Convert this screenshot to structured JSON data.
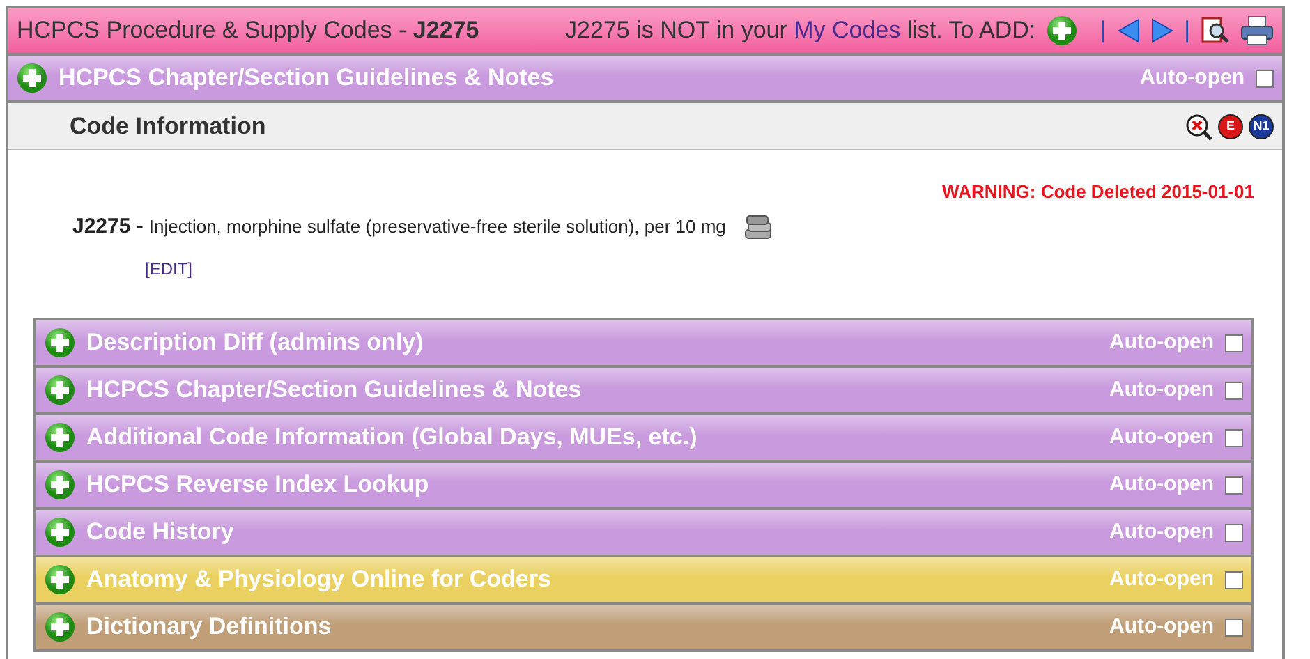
{
  "header": {
    "title": "HCPCS Procedure & Supply Codes - **J2275**",
    "notice_before": "J2275 is NOT in your ",
    "notice_link": "My Codes",
    "notice_after": " list. To ADD:",
    "separators": [
      "|",
      "|"
    ]
  },
  "top_section": {
    "title": "HCPCS Chapter/Section Guidelines & Notes",
    "auto_open_label": "Auto-open",
    "auto_open": false,
    "color": "#c99ade"
  },
  "code_information": {
    "title": "Code Information",
    "badges": [
      "E",
      "N1"
    ],
    "warning": "WARNING: Code Deleted 2015-01-01",
    "code": "J2275 -",
    "description": "Injection, morphine sulfate (preservative-free sterile solution), per 10 mg",
    "edit_link": "[EDIT]"
  },
  "sections": [
    {
      "title": "Description Diff (admins only)",
      "auto_open_label": "Auto-open",
      "auto_open": false,
      "color": "#c99ade"
    },
    {
      "title": "HCPCS Chapter/Section Guidelines & Notes",
      "auto_open_label": "Auto-open",
      "auto_open": false,
      "color": "#c99ade"
    },
    {
      "title": "Additional Code Information (Global Days, MUEs, etc.)",
      "auto_open_label": "Auto-open",
      "auto_open": false,
      "color": "#c99ade"
    },
    {
      "title": "HCPCS Reverse Index Lookup",
      "auto_open_label": "Auto-open",
      "auto_open": false,
      "color": "#c99ade"
    },
    {
      "title": "Code History",
      "auto_open_label": "Auto-open",
      "auto_open": false,
      "color": "#c99ade"
    },
    {
      "title": "Anatomy & Physiology Online for Coders",
      "auto_open_label": "Auto-open",
      "auto_open": false,
      "color": "#ead060"
    },
    {
      "title": "Dictionary Definitions",
      "auto_open_label": "Auto-open",
      "auto_open": false,
      "color": "#bf9e78"
    }
  ]
}
